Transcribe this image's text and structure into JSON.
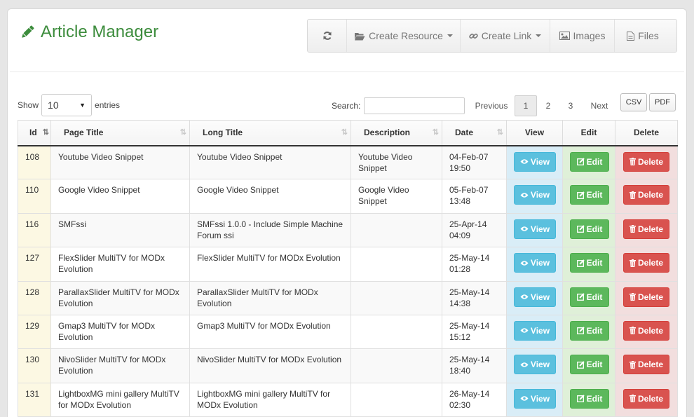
{
  "header": {
    "title": "Article Manager"
  },
  "toolbar": {
    "create_resource": "Create Resource",
    "create_link": "Create Link",
    "images": "Images",
    "files": "Files"
  },
  "length": {
    "show": "Show",
    "value": "10",
    "entries": "entries"
  },
  "search": {
    "label": "Search:",
    "value": ""
  },
  "pager": {
    "previous": "Previous",
    "pages": [
      "1",
      "2",
      "3"
    ],
    "current": "1",
    "next": "Next"
  },
  "export": {
    "csv": "CSV",
    "pdf": "PDF"
  },
  "table": {
    "columns": [
      "Id",
      "Page Title",
      "Long Title",
      "Description",
      "Date",
      "View",
      "Edit",
      "Delete"
    ],
    "view_label": "View",
    "edit_label": "Edit",
    "delete_label": "Delete",
    "rows": [
      [
        "108",
        "Youtube Video Snippet",
        "Youtube Video Snippet",
        "Youtube Video Snippet",
        "04-Feb-07 19:50"
      ],
      [
        "110",
        "Google Video Snippet",
        "Google Video Snippet",
        "Google Video Snippet",
        "05-Feb-07 13:48"
      ],
      [
        "116",
        "SMFssi",
        "SMFssi 1.0.0 - Include Simple Machine Forum ssi",
        "",
        "25-Apr-14 04:09"
      ],
      [
        "127",
        "FlexSlider MultiTV for MODx Evolution",
        "FlexSlider MultiTV for MODx Evolution",
        "",
        "25-May-14 01:28"
      ],
      [
        "128",
        "ParallaxSlider MultiTV for MODx Evolution",
        "ParallaxSlider MultiTV for MODx Evolution",
        "",
        "25-May-14 14:38"
      ],
      [
        "129",
        "Gmap3 MultiTV for MODx Evolution",
        "Gmap3 MultiTV for MODx Evolution",
        "",
        "25-May-14 15:12"
      ],
      [
        "130",
        "NivoSlider MultiTV for MODx Evolution",
        "NivoSlider MultiTV for MODx Evolution",
        "",
        "25-May-14 18:40"
      ],
      [
        "131",
        "LightboxMG mini gallery MultiTV for MODx Evolution",
        "LightboxMG mini gallery MultiTV for MODx Evolution",
        "",
        "26-May-14 02:30"
      ]
    ]
  },
  "colors": {
    "title": "#3c8c3c",
    "view": "#5bc0de",
    "edit": "#5cb85c",
    "delete": "#d9534f"
  }
}
